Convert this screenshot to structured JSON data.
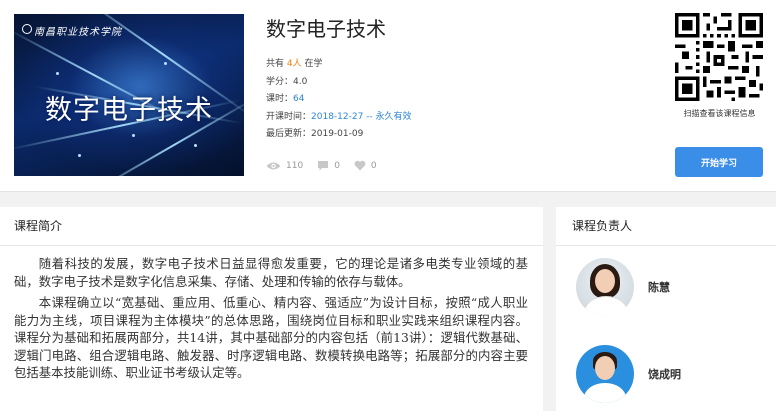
{
  "course": {
    "cover_school": "南昌职业技术学院",
    "cover_title": "数字电子技术",
    "title": "数字电子技术",
    "enroll_prefix": "共有",
    "enroll_count": "4人",
    "enroll_suffix": "在学",
    "credit_label": "学分：",
    "credit_value": "4.0",
    "hours_label": "课时：",
    "hours_value": "64",
    "open_label": "开课时间：",
    "open_value": "2018-12-27 -- 永久有效",
    "updated_label": "最后更新：",
    "updated_value": "2019-01-09",
    "views": "110",
    "comments": "0",
    "likes": "0"
  },
  "qr": {
    "caption": "扫描查看该课程信息"
  },
  "actions": {
    "start_label": "开始学习"
  },
  "intro": {
    "header": "课程简介",
    "paragraphs": [
      "随着科技的发展，数字电子技术日益显得愈发重要，它的理论是诸多电类专业领域的基础，数字电子技术是数字化信息采集、存储、处理和传输的依存与载体。",
      "本课程确立以“宽基础、重应用、低重心、精内容、强适应”为设计目标，按照“成人职业能力为主线，项目课程为主体模块”的总体思路，围绕岗位目标和职业实践来组织课程内容。课程分为基础和拓展两部分，共14讲，其中基础部分的内容包括（前13讲）：逻辑代数基础、逻辑门电路、组合逻辑电路、触发器、时序逻辑电路、数模转换电路等；拓展部分的内容主要包括基本技能训练、职业证书考级认定等。"
    ]
  },
  "teachers": {
    "header": "课程负责人",
    "list": [
      {
        "name": "陈慧"
      },
      {
        "name": "饶成明"
      }
    ]
  },
  "colors": {
    "accent": "#3b8ee8",
    "orange": "#f0830b",
    "link_blue": "#2d87d6"
  },
  "icons": [
    "eye-icon",
    "comment-icon",
    "heart-icon",
    "qr-code"
  ]
}
